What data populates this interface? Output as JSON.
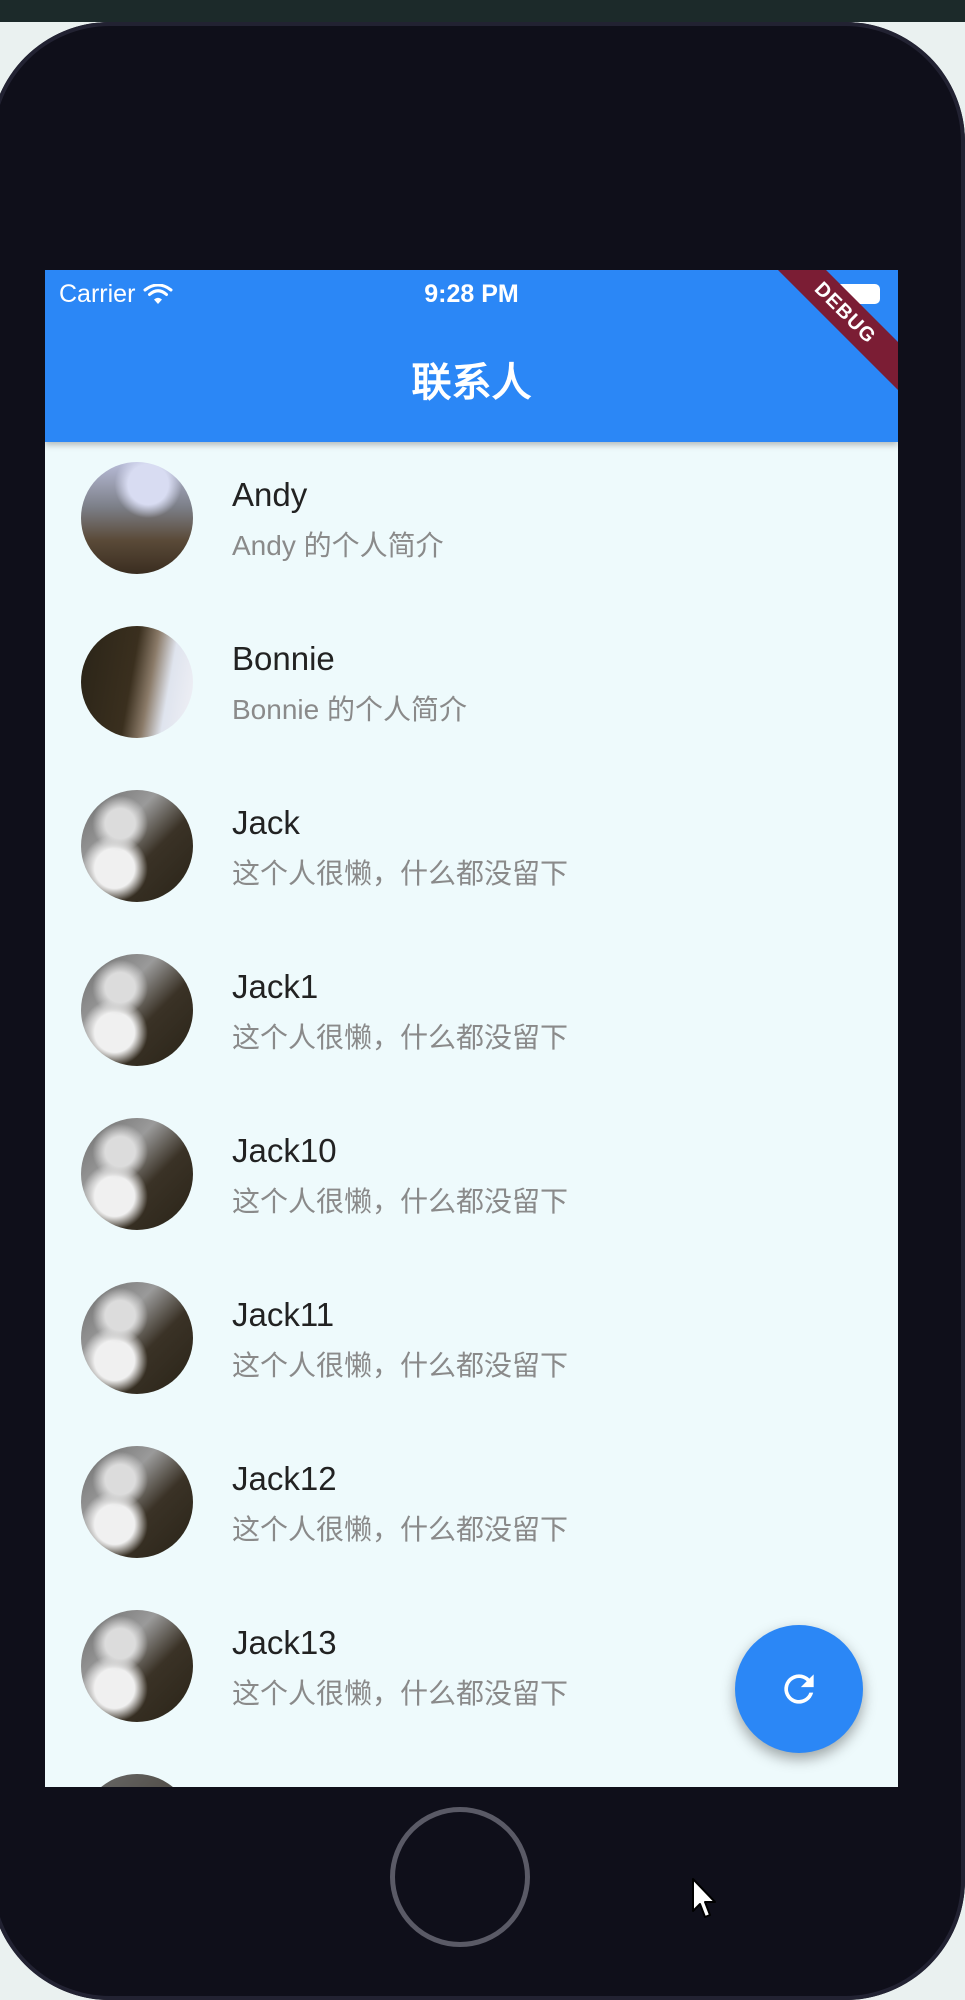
{
  "status_bar": {
    "carrier": "Carrier",
    "time": "9:28 PM"
  },
  "app_bar": {
    "title": "联系人",
    "debug_banner": "DEBUG"
  },
  "contacts": [
    {
      "name": "Andy",
      "bio": "Andy 的个人简介",
      "avatar": "andy"
    },
    {
      "name": "Bonnie",
      "bio": "Bonnie 的个人简介",
      "avatar": "bonnie"
    },
    {
      "name": "Jack",
      "bio": "这个人很懒，什么都没留下",
      "avatar": "jack"
    },
    {
      "name": "Jack1",
      "bio": "这个人很懒，什么都没留下",
      "avatar": "jack"
    },
    {
      "name": "Jack10",
      "bio": "这个人很懒，什么都没留下",
      "avatar": "jack"
    },
    {
      "name": "Jack11",
      "bio": "这个人很懒，什么都没留下",
      "avatar": "jack"
    },
    {
      "name": "Jack12",
      "bio": "这个人很懒，什么都没留下",
      "avatar": "jack"
    },
    {
      "name": "Jack13",
      "bio": "这个人很懒，什么都没留下",
      "avatar": "jack"
    }
  ],
  "fab": {
    "icon": "refresh-icon"
  },
  "colors": {
    "primary": "#2b87f6",
    "list_background": "#eefafc",
    "debug_banner": "#7b1d34",
    "device_frame": "#0f0f1a"
  }
}
